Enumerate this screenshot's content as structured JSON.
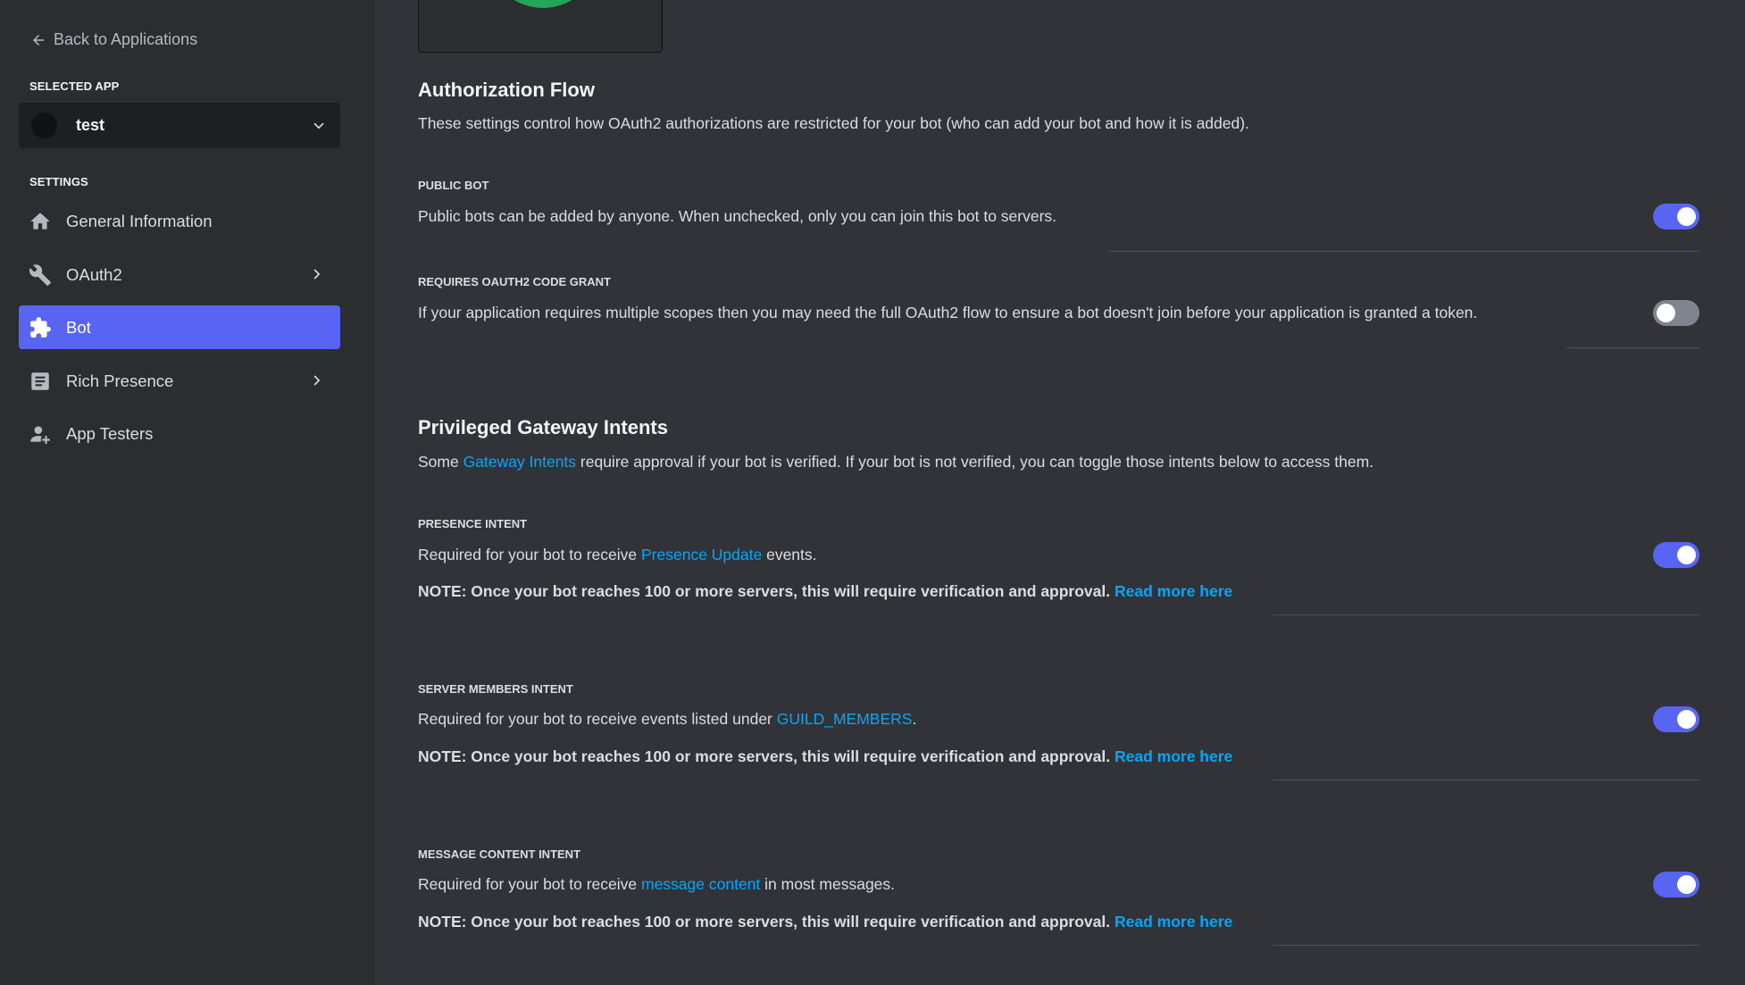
{
  "sidebar": {
    "back_label": "Back to Applications",
    "selected_app_label": "SELECTED APP",
    "app_name": "test",
    "settings_label": "SETTINGS",
    "items": [
      {
        "label": "General Information",
        "icon": "home-icon"
      },
      {
        "label": "OAuth2",
        "icon": "wrench-icon"
      },
      {
        "label": "Bot",
        "icon": "puzzle-icon",
        "active": true
      },
      {
        "label": "Rich Presence",
        "icon": "document-icon"
      },
      {
        "label": "App Testers",
        "icon": "user-add-icon"
      }
    ]
  },
  "auth_flow": {
    "title": "Authorization Flow",
    "description": "These settings control how OAuth2 authorizations are restricted for your bot (who can add your bot and how it is added).",
    "public_bot": {
      "label": "PUBLIC BOT",
      "text": "Public bots can be added by anyone. When unchecked, only you can join this bot to servers.",
      "enabled": true
    },
    "code_grant": {
      "label": "REQUIRES OAUTH2 CODE GRANT",
      "text": "If your application requires multiple scopes then you may need the full OAuth2 flow to ensure a bot doesn't join before your application is granted a token.",
      "enabled": false
    }
  },
  "intents": {
    "title": "Privileged Gateway Intents",
    "desc_pre": "Some ",
    "desc_link": "Gateway Intents",
    "desc_post": " require approval if your bot is verified. If your bot is not verified, you can toggle those intents below to access them.",
    "note_text": "NOTE: Once your bot reaches 100 or more servers, this will require verification and approval. ",
    "read_more": "Read more here",
    "presence": {
      "label": "PRESENCE INTENT",
      "pre": "Required for your bot to receive ",
      "link": "Presence Update",
      "post": " events.",
      "enabled": true
    },
    "members": {
      "label": "SERVER MEMBERS INTENT",
      "pre": "Required for your bot to receive events listed under ",
      "link": "GUILD_MEMBERS",
      "post": ".",
      "enabled": true
    },
    "message": {
      "label": "MESSAGE CONTENT INTENT",
      "pre": "Required for your bot to receive ",
      "link": "message content",
      "post": " in most messages.",
      "enabled": true
    }
  },
  "colors": {
    "accent": "#5865f2",
    "link": "#00a8fc",
    "avatar_green": "#23a55a"
  }
}
